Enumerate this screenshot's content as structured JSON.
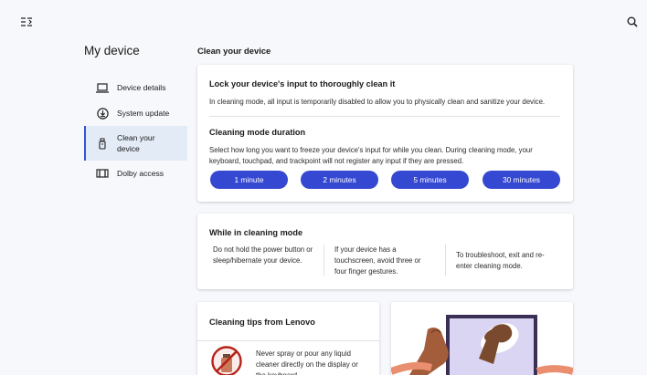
{
  "header": {
    "menu_icon": "menu-collapse-icon",
    "search_icon": "search-icon"
  },
  "page": {
    "title": "My device"
  },
  "sidebar": {
    "items": [
      {
        "label": "Device details",
        "icon": "laptop-icon"
      },
      {
        "label": "System update",
        "icon": "download-circle-icon"
      },
      {
        "label": "Clean your device",
        "icon": "spray-bottle-icon",
        "active": true
      },
      {
        "label": "Dolby access",
        "icon": "dolby-icon"
      }
    ]
  },
  "main": {
    "section_title": "Clean your device",
    "lock_card": {
      "heading": "Lock your device's input to thoroughly clean it",
      "description": "In cleaning mode, all input is temporarily disabled to allow you to physically clean and sanitize your device.",
      "duration_heading": "Cleaning mode duration",
      "duration_description": "Select how long you want to freeze your device's input for while you clean. During cleaning mode, your keyboard, touchpad, and trackpoint will not register any input if they are pressed.",
      "buttons": [
        "1 minute",
        "2 minutes",
        "5 minutes",
        "30 minutes"
      ]
    },
    "while_card": {
      "heading": "While in cleaning mode",
      "columns": [
        "Do not hold the power button or sleep/hibernate your device.",
        "If your device has a touchscreen, avoid three or four finger gestures.",
        "To troubleshoot, exit and re-enter cleaning mode."
      ]
    },
    "tips_card": {
      "heading": "Cleaning tips from Lenovo",
      "tip_text": "Never spray or pour any liquid cleaner directly on the display or the keyboard."
    }
  },
  "colors": {
    "accent": "#3548d2",
    "active_bg": "#e3ebf7"
  }
}
